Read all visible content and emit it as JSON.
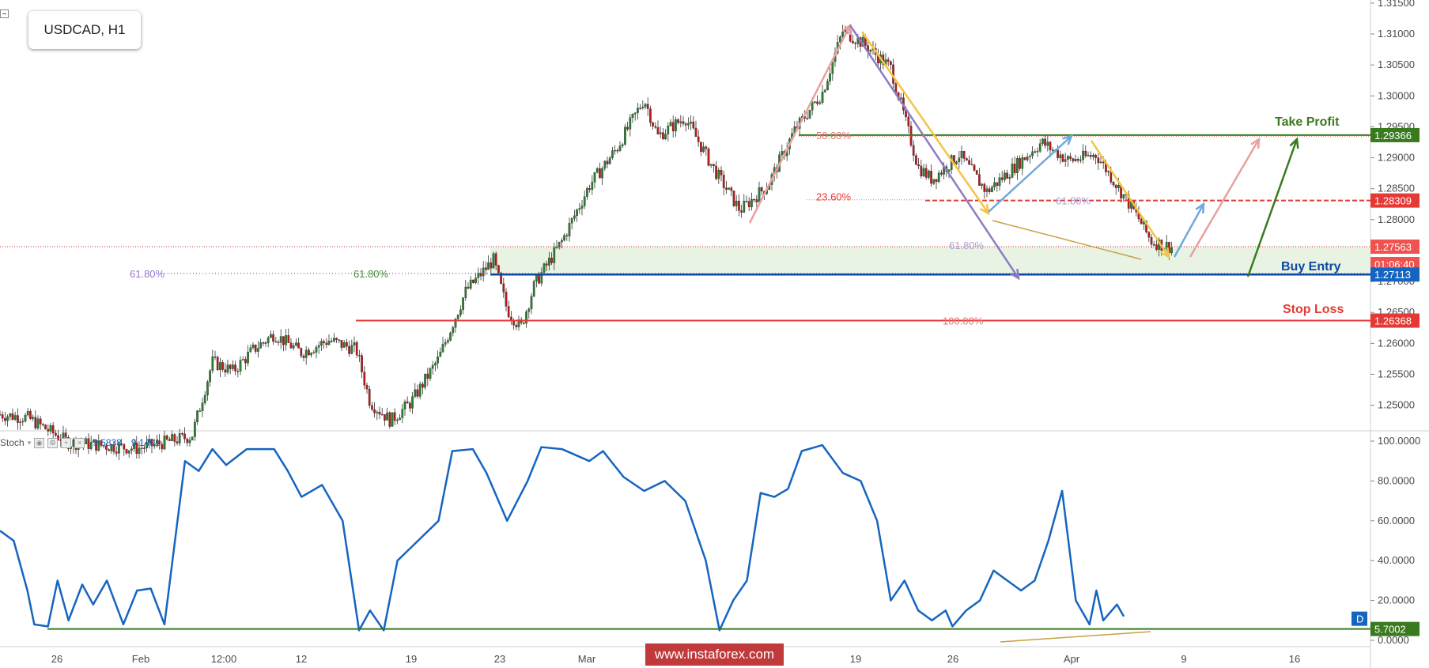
{
  "symbol": "USDCAD, H1",
  "stoch": {
    "name": "Stoch",
    "k": "9.5838",
    "d": "9.1401",
    "current_label": "5.7002",
    "badge": "D"
  },
  "watermark": "www.instaforex.com",
  "colors": {
    "up": "#2e7d32",
    "down": "#b71c1c",
    "take_profit": "#3a7a1e",
    "stop_loss": "#e53935",
    "buy_entry": "#0d47a1",
    "stoch_line": "#1565c0",
    "zone": "#e8f3e4"
  },
  "annotations": {
    "take_profit": {
      "label": "Take Profit",
      "price": "1.29366"
    },
    "buy_entry": {
      "label": "Buy Entry",
      "price": "1.27113",
      "timer": "01:06:40"
    },
    "stop_loss": {
      "label": "Stop Loss",
      "price": "1.26368"
    },
    "resistance": {
      "price": "1.28309"
    },
    "current": {
      "price": "1.27563"
    },
    "fib_labels": [
      "50.00%",
      "23.60%",
      "61.80%",
      "61.80%",
      "61.80%",
      "61.80%",
      "100.00%"
    ]
  },
  "chart_data": [
    {
      "type": "candlestick",
      "title": "USDCAD, H1",
      "ylim": [
        1.2465,
        1.3155
      ],
      "y_ticks": [
        "1.31500",
        "1.31000",
        "1.30500",
        "1.30000",
        "1.29500",
        "1.29000",
        "1.28500",
        "1.28000",
        "1.27500",
        "1.27000",
        "1.26500",
        "1.26000",
        "1.25500",
        "1.25000"
      ],
      "x_ticks": [
        "26",
        "Feb",
        "12:00",
        "12",
        "19",
        "23",
        "Mar",
        "12:00",
        "12",
        "19",
        "26",
        "Apr",
        "9",
        "16"
      ],
      "price_path": [
        [
          0,
          1.2485
        ],
        [
          0.02,
          1.248
        ],
        [
          0.05,
          1.244
        ],
        [
          0.1,
          1.243
        ],
        [
          0.14,
          1.245
        ],
        [
          0.155,
          1.257
        ],
        [
          0.17,
          1.2555
        ],
        [
          0.185,
          1.259
        ],
        [
          0.2,
          1.2615
        ],
        [
          0.22,
          1.2585
        ],
        [
          0.24,
          1.2605
        ],
        [
          0.26,
          1.259
        ],
        [
          0.27,
          1.2505
        ],
        [
          0.285,
          1.2475
        ],
        [
          0.3,
          1.2505
        ],
        [
          0.32,
          1.2575
        ],
        [
          0.34,
          1.2685
        ],
        [
          0.36,
          1.2735
        ],
        [
          0.37,
          1.2655
        ],
        [
          0.38,
          1.2625
        ],
        [
          0.39,
          1.2695
        ],
        [
          0.41,
          1.2765
        ],
        [
          0.43,
          1.2855
        ],
        [
          0.45,
          1.2915
        ],
        [
          0.47,
          1.2995
        ],
        [
          0.48,
          1.2935
        ],
        [
          0.5,
          1.2965
        ],
        [
          0.52,
          1.2885
        ],
        [
          0.54,
          1.2815
        ],
        [
          0.56,
          1.2855
        ],
        [
          0.58,
          1.2945
        ],
        [
          0.6,
          1.3005
        ],
        [
          0.615,
          1.3105
        ],
        [
          0.63,
          1.3085
        ],
        [
          0.65,
          1.3045
        ],
        [
          0.67,
          1.2885
        ],
        [
          0.68,
          1.2865
        ],
        [
          0.7,
          1.2905
        ],
        [
          0.72,
          1.2845
        ],
        [
          0.74,
          1.2885
        ],
        [
          0.76,
          1.2925
        ],
        [
          0.78,
          1.2895
        ],
        [
          0.8,
          1.2905
        ],
        [
          0.815,
          1.2855
        ],
        [
          0.83,
          1.2805
        ],
        [
          0.84,
          1.2765
        ],
        [
          0.855,
          1.2755
        ]
      ],
      "levels": {
        "take_profit": 1.29366,
        "resistance": 1.28309,
        "current": 1.27563,
        "buy_entry": 1.27113,
        "stop_loss": 1.26368
      }
    },
    {
      "type": "line",
      "title": "Stoch",
      "ylim": [
        0,
        100
      ],
      "y_ticks": [
        "100.0000",
        "80.0000",
        "60.0000",
        "40.0000",
        "20.0000",
        "0.0000"
      ],
      "series": [
        {
          "name": "Stoch",
          "values": [
            [
              0,
              55
            ],
            [
              0.01,
              50
            ],
            [
              0.02,
              25
            ],
            [
              0.025,
              8
            ],
            [
              0.035,
              7
            ],
            [
              0.042,
              30
            ],
            [
              0.05,
              10
            ],
            [
              0.06,
              28
            ],
            [
              0.068,
              18
            ],
            [
              0.078,
              30
            ],
            [
              0.09,
              8
            ],
            [
              0.1,
              25
            ],
            [
              0.11,
              26
            ],
            [
              0.12,
              8
            ],
            [
              0.135,
              90
            ],
            [
              0.145,
              85
            ],
            [
              0.155,
              96
            ],
            [
              0.165,
              88
            ],
            [
              0.18,
              96
            ],
            [
              0.2,
              96
            ],
            [
              0.21,
              85
            ],
            [
              0.22,
              72
            ],
            [
              0.235,
              78
            ],
            [
              0.25,
              60
            ],
            [
              0.262,
              5
            ],
            [
              0.27,
              15
            ],
            [
              0.28,
              5
            ],
            [
              0.29,
              40
            ],
            [
              0.305,
              50
            ],
            [
              0.32,
              60
            ],
            [
              0.33,
              95
            ],
            [
              0.345,
              96
            ],
            [
              0.355,
              84
            ],
            [
              0.37,
              60
            ],
            [
              0.385,
              80
            ],
            [
              0.395,
              97
            ],
            [
              0.41,
              96
            ],
            [
              0.43,
              90
            ],
            [
              0.44,
              95
            ],
            [
              0.455,
              82
            ],
            [
              0.47,
              75
            ],
            [
              0.485,
              80
            ],
            [
              0.5,
              70
            ],
            [
              0.515,
              40
            ],
            [
              0.525,
              5
            ],
            [
              0.535,
              20
            ],
            [
              0.545,
              30
            ],
            [
              0.555,
              74
            ],
            [
              0.565,
              72
            ],
            [
              0.575,
              76
            ],
            [
              0.585,
              95
            ],
            [
              0.6,
              98
            ],
            [
              0.615,
              84
            ],
            [
              0.628,
              80
            ],
            [
              0.64,
              60
            ],
            [
              0.65,
              20
            ],
            [
              0.66,
              30
            ],
            [
              0.67,
              15
            ],
            [
              0.68,
              10
            ],
            [
              0.69,
              15
            ],
            [
              0.695,
              7
            ],
            [
              0.705,
              15
            ],
            [
              0.715,
              20
            ],
            [
              0.725,
              35
            ],
            [
              0.735,
              30
            ],
            [
              0.745,
              25
            ],
            [
              0.755,
              30
            ],
            [
              0.765,
              50
            ],
            [
              0.775,
              75
            ],
            [
              0.785,
              20
            ],
            [
              0.795,
              8
            ],
            [
              0.8,
              25
            ],
            [
              0.805,
              10
            ],
            [
              0.815,
              18
            ],
            [
              0.82,
              12
            ]
          ]
        }
      ]
    }
  ]
}
